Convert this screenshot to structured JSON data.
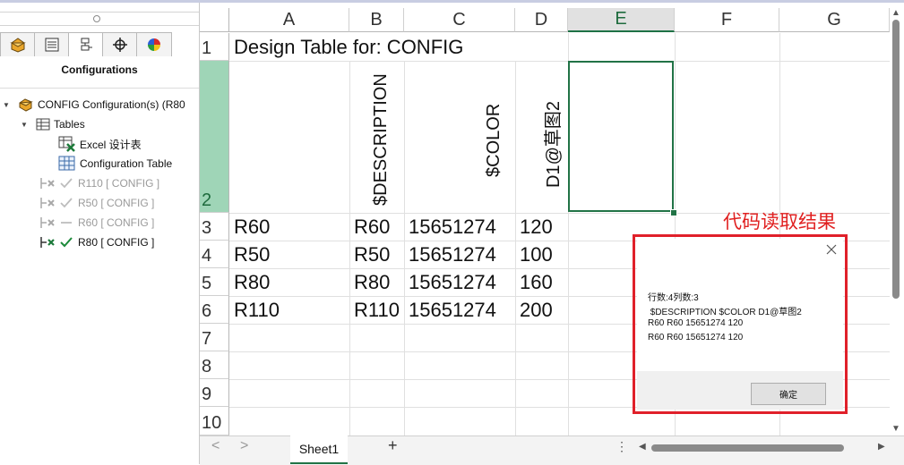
{
  "panel": {
    "title": "Configurations",
    "tree": {
      "root": "CONFIG Configuration(s)  (R80",
      "tables": "Tables",
      "excel": "Excel 设计表",
      "config_table": "Configuration Table",
      "configs": [
        {
          "label": "R110 [ CONFIG ]",
          "active": false
        },
        {
          "label": "R50 [ CONFIG ]",
          "active": false
        },
        {
          "label": "R60 [ CONFIG ]",
          "active": false
        },
        {
          "label": "R80 [ CONFIG ]",
          "active": true
        }
      ]
    }
  },
  "sheet": {
    "columns": [
      "A",
      "B",
      "C",
      "D",
      "E",
      "F",
      "G"
    ],
    "selected_column": "E",
    "rows": [
      "1",
      "2",
      "3",
      "4",
      "5",
      "6",
      "7",
      "8",
      "9",
      "10"
    ],
    "selected_row": "2",
    "title_cell": "Design Table for: CONFIG",
    "headers": [
      "$DESCRIPTION",
      "$COLOR",
      "D1@草图2"
    ],
    "data": [
      [
        "R60",
        "R60",
        "15651274",
        "120"
      ],
      [
        "R50",
        "R50",
        "15651274",
        "100"
      ],
      [
        "R80",
        "R80",
        "15651274",
        "160"
      ],
      [
        "R110",
        "R110",
        "15651274",
        "200"
      ]
    ],
    "tab_name": "Sheet1",
    "add_tab": "+",
    "nav_prev": "<",
    "nav_next": ">",
    "more": "⋮"
  },
  "annotation": "代码读取结果",
  "dialog": {
    "lines": [
      "行数:4列数:3",
      " $DESCRIPTION $COLOR D1@草图2",
      "R60 R60 15651274 120",
      "R60 R60 15651274 120"
    ],
    "ok_label": "确定"
  }
}
